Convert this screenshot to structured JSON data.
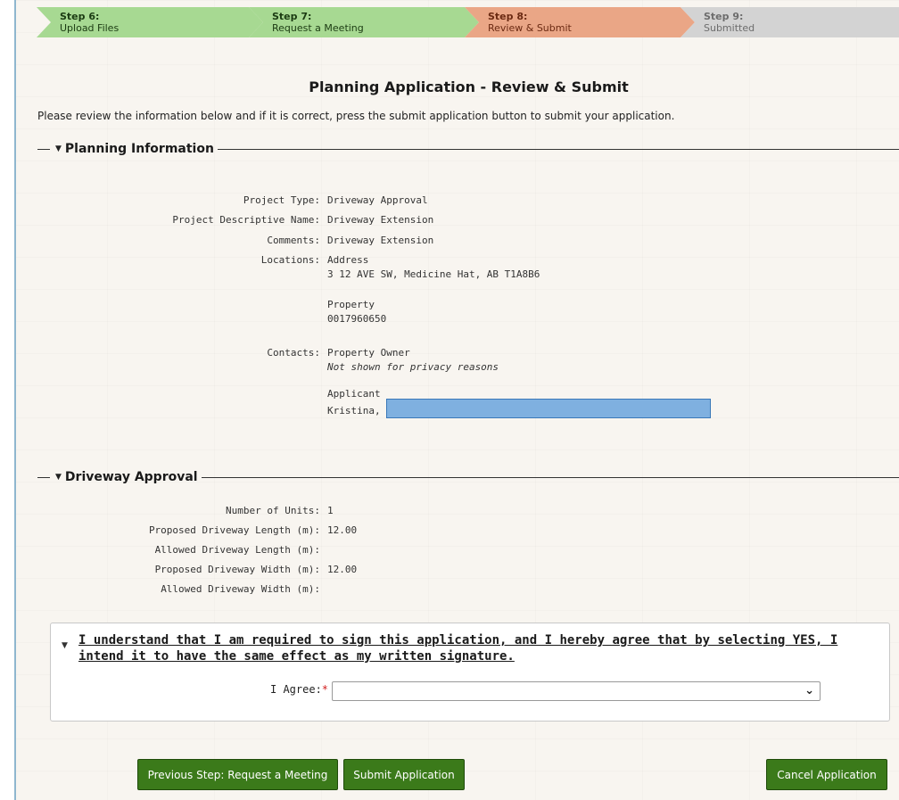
{
  "steps": [
    {
      "num": "Step 6:",
      "name": "Upload Files",
      "state": "done"
    },
    {
      "num": "Step 7:",
      "name": "Request a Meeting",
      "state": "done"
    },
    {
      "num": "Step 8:",
      "name": "Review & Submit",
      "state": "current"
    },
    {
      "num": "Step 9:",
      "name": "Submitted",
      "state": "future"
    }
  ],
  "page_title": "Planning Application - Review & Submit",
  "intro": "Please review the information below and if it is correct, press the submit application button to submit your application.",
  "planning": {
    "title": "Planning Information",
    "project_type_label": "Project Type:",
    "project_type": "Driveway Approval",
    "descriptive_name_label": "Project Descriptive Name:",
    "descriptive_name": "Driveway Extension",
    "comments_label": "Comments:",
    "comments": "Driveway Extension",
    "locations_label": "Locations:",
    "address_heading": "Address",
    "address": "3 12 AVE SW, Medicine Hat, AB T1A8B6",
    "property_heading": "Property",
    "property_id": "0017960650",
    "contacts_label": "Contacts:",
    "owner_heading": "Property Owner",
    "owner_note": "Not shown for privacy reasons",
    "applicant_heading": "Applicant",
    "applicant_name": "Kristina,"
  },
  "driveway": {
    "title": "Driveway Approval",
    "units_label": "Number of Units:",
    "units": "1",
    "proposed_length_label": "Proposed Driveway Length (m):",
    "proposed_length": "12.00",
    "allowed_length_label": "Allowed Driveway Length (m):",
    "allowed_length": "",
    "proposed_width_label": "Proposed Driveway Width (m):",
    "proposed_width": "12.00",
    "allowed_width_label": "Allowed Driveway Width (m):",
    "allowed_width": ""
  },
  "agreement": {
    "text": "I understand that I am required to sign this application, and I hereby agree that by selecting YES, I intend it to have the same effect as my written signature.",
    "label": "I Agree:",
    "required_mark": "*",
    "selected": ""
  },
  "buttons": {
    "previous": "Previous Step: Request a Meeting",
    "submit": "Submit Application",
    "cancel": "Cancel Application"
  },
  "colors": {
    "step_done": "#a7d992",
    "step_current": "#eaa686",
    "step_future": "#d3d3d3",
    "button": "#3b7a1a"
  }
}
